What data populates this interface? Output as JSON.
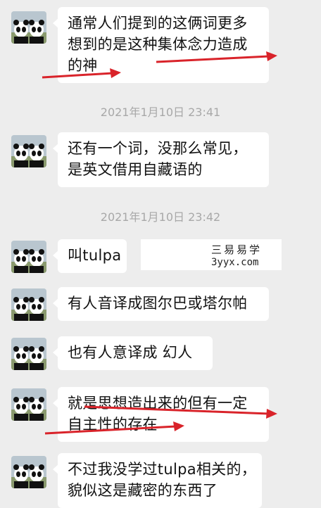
{
  "timestamps": [
    "2021年1月10日 23:41",
    "2021年1月10日 23:42"
  ],
  "messages": [
    {
      "lines": [
        "通常人们提到的这俩词更多",
        "想到的是这种集体念力造成",
        "的神"
      ]
    },
    {
      "lines": [
        "还有一个词，没那么常见，",
        "是英文借用自藏语的"
      ]
    },
    {
      "lines": [
        "叫tulpa"
      ]
    },
    {
      "lines": [
        "有人音译成图尔巴或塔尔帕"
      ]
    },
    {
      "lines": [
        "也有人意译成 幻人"
      ]
    },
    {
      "lines": [
        "就是思想造出来的但有一定",
        "自主性的存在"
      ]
    },
    {
      "lines": [
        "不过我没学过tulpa相关的，",
        "貌似这是藏密的东西了"
      ]
    }
  ],
  "watermark": {
    "title": "三易易学",
    "url": "3yyx.com"
  },
  "colors": {
    "background": "#ededed",
    "bubble": "#ffffff",
    "arrow": "#d9232a",
    "timestamp": "#a8a8a8"
  }
}
